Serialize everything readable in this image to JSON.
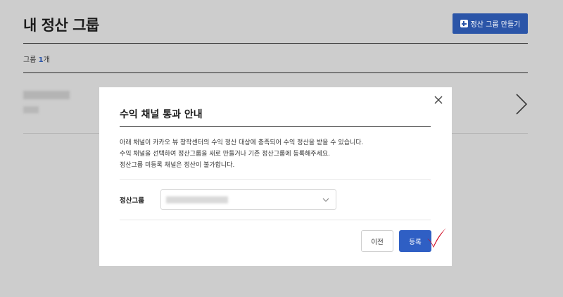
{
  "page": {
    "title": "내 정산 그룹",
    "create_button_label": "정산 그룹 만들기",
    "group_count_prefix": "그룹 ",
    "group_count_number": "1",
    "group_count_suffix": "개"
  },
  "modal": {
    "title": "수익 채널 통과 안내",
    "description_lines": [
      "아래 채널이 카카오 뷰 창작센터의 수익 정산 대상에 충족되어 수익 정산을 받을 수 있습니다.",
      "수익 채널을 선택하여 정산그룹을 새로 만들거나 기존 정산그룹에 등록해주세요.",
      "정산그룹 미등록 채널은 정산이 불가합니다."
    ],
    "field_label": "정산그룹",
    "prev_button_label": "이전",
    "register_button_label": "등록"
  },
  "icons": {
    "create": "plus-square-icon",
    "row_arrow": "chevron-right-icon",
    "close": "close-icon",
    "select_arrow": "chevron-down-icon",
    "annotation": "red-checkmark-icon"
  },
  "colors": {
    "accent": "#2b55a8",
    "register_button": "#2f5fc4",
    "checkmark": "#d0021b",
    "overlay": "#cdcdcd"
  }
}
